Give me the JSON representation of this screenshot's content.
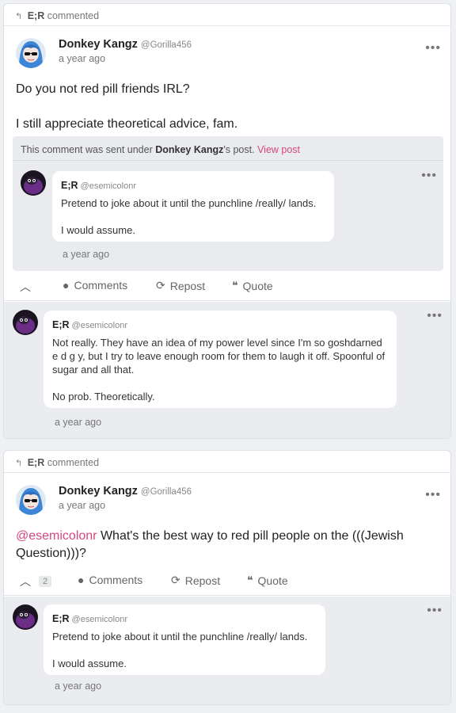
{
  "cards": [
    {
      "activity": {
        "actor": "E;R",
        "label": "commented"
      },
      "post": {
        "author": "Donkey Kangz",
        "handle": "@Gorilla456",
        "time": "a year ago",
        "line1": "Do you not red pill friends IRL?",
        "line2": "I still appreciate theoretical advice, fam."
      },
      "context": {
        "prefix": "This comment was sent under ",
        "post_author": "Donkey Kangz",
        "suffix": "'s post.",
        "link": "View post",
        "comment": {
          "author": "E;R",
          "handle": "@esemicolonr",
          "line1": "Pretend to joke about it until the punchline /really/ lands.",
          "line2": "I would assume.",
          "time": "a year ago"
        }
      },
      "actions": {
        "comments": "Comments",
        "repost": "Repost",
        "quote": "Quote"
      },
      "reply": {
        "author": "E;R",
        "handle": "@esemicolonr",
        "line1": "Not really. They have an idea of my power level since I'm so goshdarned e d g y, but I try to leave enough room for them to laugh it off. Spoonful of sugar and all that.",
        "line2": "No prob. Theoretically.",
        "time": "a year ago"
      }
    },
    {
      "activity": {
        "actor": "E;R",
        "label": "commented"
      },
      "post": {
        "author": "Donkey Kangz",
        "handle": "@Gorilla456",
        "time": "a year ago",
        "mention": "@esemicolonr",
        "text": " What's the best way to red pill people on the (((Jewish Question)))?"
      },
      "actions": {
        "count": "2",
        "comments": "Comments",
        "repost": "Repost",
        "quote": "Quote"
      },
      "reply": {
        "author": "E;R",
        "handle": "@esemicolonr",
        "line1": "Pretend to joke about it until the punchline /really/ lands.",
        "line2": "I would assume.",
        "time": "a year ago"
      }
    }
  ],
  "icons": {
    "reply": "↰",
    "menu": "•••",
    "chevron_up": "︿",
    "comment": "●",
    "repost": "⟳",
    "quote": "❝"
  },
  "colors": {
    "accent": "#d4467e"
  }
}
